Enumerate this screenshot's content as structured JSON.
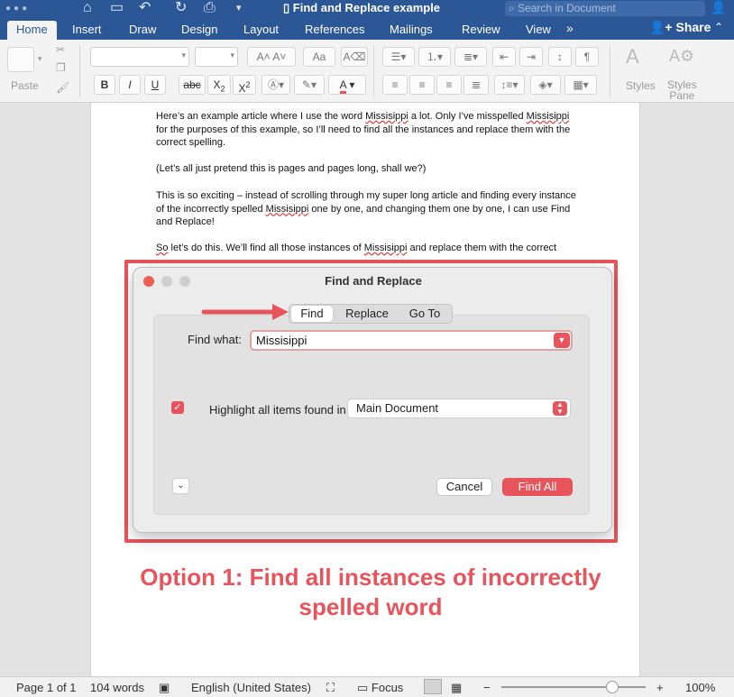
{
  "titlebar": {
    "doc_title": "Find and Replace example",
    "search_placeholder": "Search in Document"
  },
  "tabs": [
    {
      "label": "Home",
      "active": true
    },
    {
      "label": "Insert"
    },
    {
      "label": "Draw"
    },
    {
      "label": "Design"
    },
    {
      "label": "Layout"
    },
    {
      "label": "References"
    },
    {
      "label": "Mailings"
    },
    {
      "label": "Review"
    },
    {
      "label": "View"
    }
  ],
  "ribbon": {
    "paste_label": "Paste",
    "styles_label": "Styles",
    "styles_pane_label_1": "Styles",
    "styles_pane_label_2": "Pane",
    "bold": "B",
    "italic": "I",
    "underline": "U",
    "strikethrough": "abc",
    "subscript": "X",
    "subscript_mark": "2",
    "superscript": "X",
    "superscript_mark": "2",
    "font_color": "A",
    "share_label": "Share"
  },
  "document": {
    "p1_a": "Here’s an example article where I use the word ",
    "p1_w1": "Missisippi",
    "p1_b": " a lot. Only I’ve misspelled ",
    "p1_w2": "Missisippi",
    "p1_c": " for the purposes of this example, so I’ll need to find all the instances and replace them with the correct spelling.",
    "p2": "(Let’s all just pretend this is pages and pages long, shall we?)",
    "p3_a": "This is so exciting – instead of scrolling through my super long article and finding every instance of the incorrectly spelled ",
    "p3_w": "Missisippi",
    "p3_b": " one by one, and changing them one by one, I can use Find and Replace!",
    "p4_so": "So",
    "p4_a": " let’s do this. We’ll find all those instances of ",
    "p4_w": "Missisippi",
    "p4_b": " and replace them with the correct"
  },
  "dialog": {
    "title": "Find and Replace",
    "tabs": [
      "Find",
      "Replace",
      "Go To"
    ],
    "find_what_label": "Find what:",
    "find_what_value": "Missisippi",
    "highlight_label": "Highlight all items found in:",
    "highlight_checked": true,
    "scope_value": "Main Document",
    "cancel_label": "Cancel",
    "find_all_label": "Find All"
  },
  "annotation": {
    "line1": "Option 1: Find all instances of incorrectly",
    "line2": "spelled word"
  },
  "status": {
    "page": "Page 1 of 1",
    "words": "104 words",
    "language": "English (United States)",
    "focus": "Focus",
    "zoom": "100%"
  },
  "colors": {
    "accent": "#2b5797",
    "highlight_red": "#e8545c"
  }
}
